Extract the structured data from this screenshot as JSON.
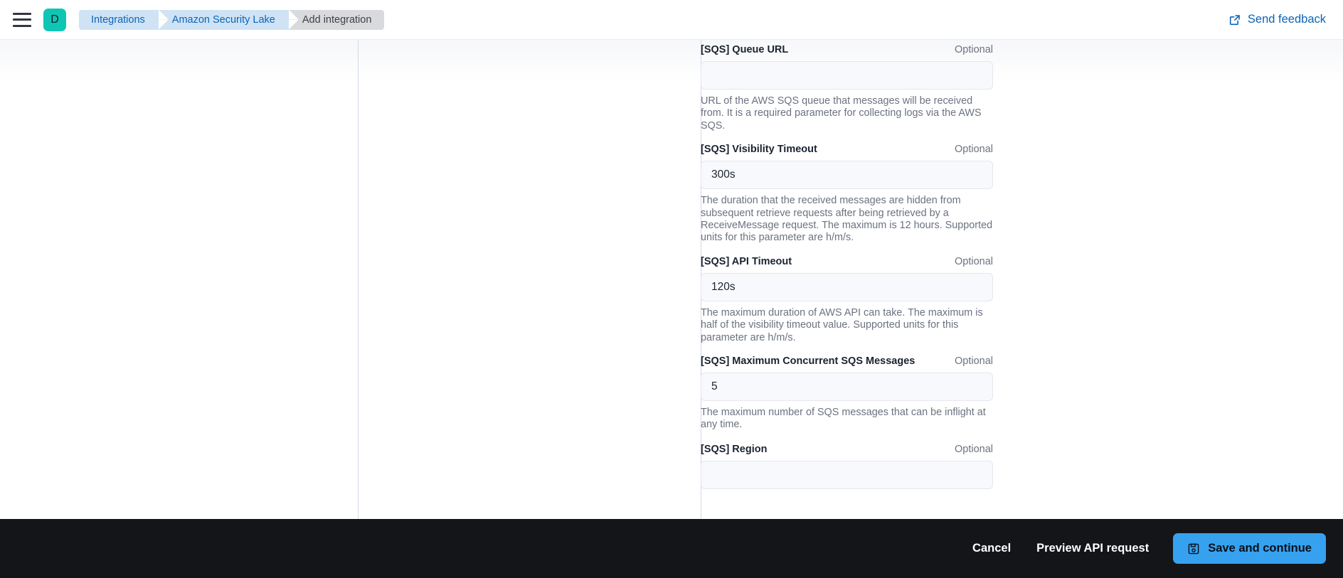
{
  "header": {
    "menu_icon": "hamburger-menu-icon",
    "avatar_initial": "D",
    "avatar_color": "#0fc6b4",
    "breadcrumbs": [
      {
        "label": "Integrations",
        "state": "link"
      },
      {
        "label": "Amazon Security Lake",
        "state": "link"
      },
      {
        "label": "Add integration",
        "state": "current"
      }
    ],
    "send_feedback": {
      "label": "Send feedback",
      "icon": "external-link-icon",
      "color": "#0b64b8"
    }
  },
  "form": {
    "optional_label": "Optional",
    "fields": [
      {
        "label": "[SQS] Queue URL",
        "optional": "Optional",
        "value": "",
        "placeholder": "",
        "help": "URL of the AWS SQS queue that messages will be received from. It is a required parameter for collecting logs via the AWS SQS."
      },
      {
        "label": "[SQS] Visibility Timeout",
        "optional": "Optional",
        "value": "300s",
        "placeholder": "",
        "help": "The duration that the received messages are hidden from subsequent retrieve requests after being retrieved by a ReceiveMessage request. The maximum is 12 hours. Supported units for this parameter are h/m/s."
      },
      {
        "label": "[SQS] API Timeout",
        "optional": "Optional",
        "value": "120s",
        "placeholder": "",
        "help": "The maximum duration of AWS API can take. The maximum is half of the visibility timeout value. Supported units for this parameter are h/m/s."
      },
      {
        "label": "[SQS] Maximum Concurrent SQS Messages",
        "optional": "Optional",
        "value": "5",
        "placeholder": "",
        "help": "The maximum number of SQS messages that can be inflight at any time."
      },
      {
        "label": "[SQS] Region",
        "optional": "Optional",
        "value": "",
        "placeholder": "",
        "help": ""
      }
    ]
  },
  "footer": {
    "cancel_label": "Cancel",
    "preview_label": "Preview API request",
    "save_label": "Save and continue",
    "save_icon": "save-floppy-disk-icon",
    "save_color": "#36a2ef",
    "background": "#141519"
  }
}
